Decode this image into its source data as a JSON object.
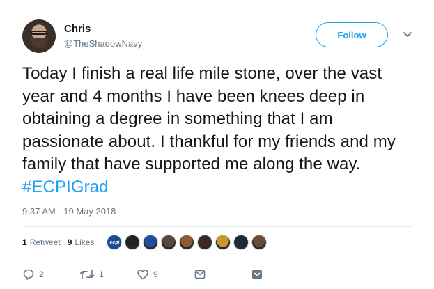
{
  "author": {
    "name": "Chris",
    "handle": "@TheShadowNavy"
  },
  "follow_button": {
    "label": "Follow"
  },
  "menu": {
    "icon": "chevron-down-icon"
  },
  "tweet": {
    "text": "Today I finish a real life mile stone, over the vast year and 4 months I have been knees deep in obtaining a degree in something that I am passionate about. I thankful for my friends and my family that have supported me along the way. ",
    "hashtag": "#ECPIGrad",
    "timestamp": "9:37 AM - 19 May 2018"
  },
  "stats": {
    "retweets_count": "1",
    "retweets_label": "Retweet",
    "likes_count": "9",
    "likes_label": "Likes",
    "liker_avatars": [
      {
        "name": "ecpi-logo-avatar",
        "color": "#1a4d8f",
        "label": "ecpi"
      },
      {
        "name": "liker-avatar-2",
        "color": "#222222"
      },
      {
        "name": "pepsi-avatar",
        "color": "#1d4fa0"
      },
      {
        "name": "liker-avatar-4",
        "color": "#5a463a"
      },
      {
        "name": "liker-avatar-5",
        "color": "#8a5a36"
      },
      {
        "name": "liker-avatar-6",
        "color": "#3a2a22"
      },
      {
        "name": "liker-avatar-7",
        "color": "#c59a2a"
      },
      {
        "name": "liker-avatar-8",
        "color": "#1c2a3a"
      },
      {
        "name": "liker-avatar-9",
        "color": "#6b4a3a"
      }
    ]
  },
  "actions": {
    "reply_count": "2",
    "retweet_count": "1",
    "like_count": "9"
  },
  "colors": {
    "accent": "#1da1f2",
    "secondary_text": "#657786",
    "divider": "#e6ecf0"
  }
}
